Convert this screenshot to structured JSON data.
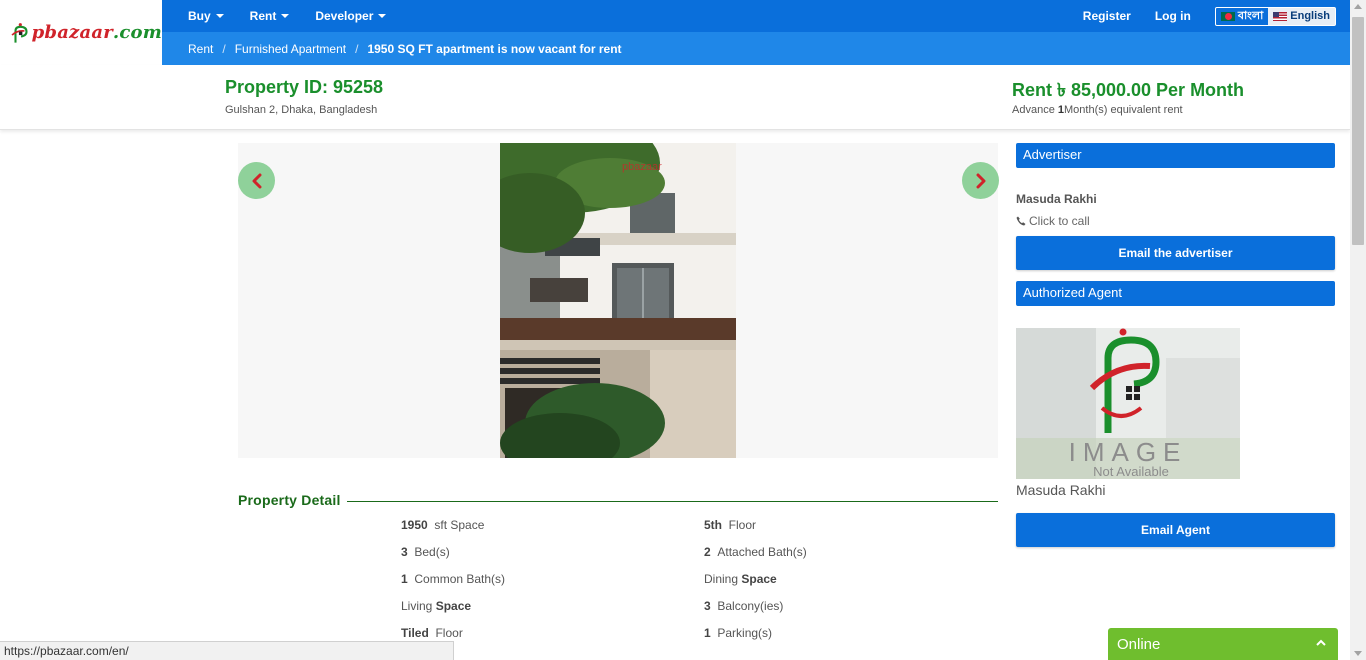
{
  "logo": {
    "text_main": "pbazaar",
    "text_suffix": ".com"
  },
  "nav": {
    "items": [
      {
        "label": "Buy"
      },
      {
        "label": "Rent"
      },
      {
        "label": "Developer"
      }
    ],
    "register": "Register",
    "login": "Log in",
    "lang_bn": "বাংলা",
    "lang_en": "English"
  },
  "breadcrumb": {
    "items": [
      "Rent",
      "Furnished Apartment",
      "1950 SQ FT apartment is now vacant for rent"
    ],
    "separator": "/"
  },
  "property": {
    "id_label": "Property ID: 95258",
    "location": "Gulshan 2, Dhaka, Bangladesh",
    "rent": "Rent ৳ 85,000.00 Per Month",
    "advance_prefix": "Advance ",
    "advance_num": "1",
    "advance_suffix": "Month(s) equivalent rent"
  },
  "gallery": {
    "watermark": "pbazaar"
  },
  "detail": {
    "title": "Property Detail",
    "features": [
      {
        "value": "1950",
        "label": "sft Space"
      },
      {
        "value": "5th",
        "label": "Floor"
      },
      {
        "value": "3",
        "label": "Bed(s)"
      },
      {
        "value": "2",
        "label": "Attached Bath(s)"
      },
      {
        "value": "1",
        "label": "Common Bath(s)"
      },
      {
        "value": "Dining",
        "label": "Space",
        "label_bold": true
      },
      {
        "value": "Living",
        "label": "Space",
        "label_bold": true
      },
      {
        "value": "3",
        "label": "Balcony(ies)"
      },
      {
        "value": "Tiled",
        "label": "Floor"
      },
      {
        "value": "1",
        "label": "Parking(s)"
      }
    ]
  },
  "sidebar": {
    "advertiser_heading": "Advertiser",
    "advertiser_name": "Masuda Rakhi",
    "click_to_call": "Click to call",
    "email_advertiser": "Email the advertiser",
    "agent_heading": "Authorized Agent",
    "agent_image_text": "IMAGE",
    "agent_image_subtext": "Not Available",
    "agent_name": "Masuda Rakhi",
    "email_agent": "Email Agent"
  },
  "status_url": "https://pbazaar.com/en/",
  "chat": {
    "label": "Online"
  },
  "colors": {
    "nav_blue": "#0a6fdb",
    "crumb_blue": "#1f87e8",
    "brand_green": "#1a8f2c",
    "chat_green": "#6fbe2e",
    "arrow_green": "#8fd19a",
    "arrow_red": "#d0232a"
  }
}
